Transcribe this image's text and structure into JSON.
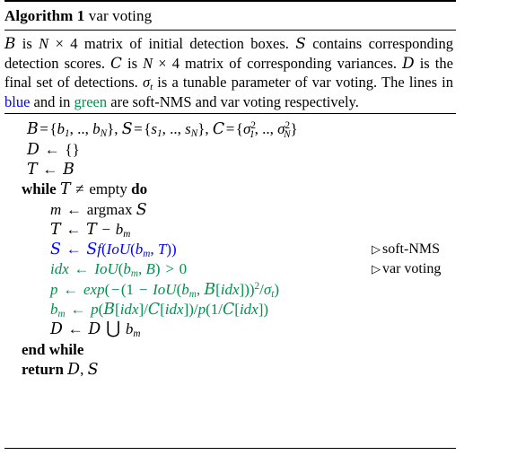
{
  "figure": {
    "type": "algorithm-block",
    "background_color": "#ffffff",
    "text_color": "#000000",
    "blue_color": "#0000ff",
    "green_color": "#00914f"
  },
  "header": {
    "label": "Algorithm 1",
    "title": "var voting"
  },
  "description": {
    "full_text": "B is N × 4 matrix of initial detection boxes. S contains corresponding detection scores. C is N × 4 matrix of corresponding variances. D is the final set of detections. σt is a tunable parameter of var voting. The lines in blue and in green are soft-NMS and var voting respectively.",
    "segments": [
      {
        "text": "B",
        "style": "mathcal"
      },
      {
        "text": " is ",
        "style": "roman"
      },
      {
        "text": "N",
        "style": "mathit"
      },
      {
        "text": " × 4 matrix of initial detection boxes. ",
        "style": "roman"
      },
      {
        "text": "S",
        "style": "mathcal"
      },
      {
        "text": " contains corresponding detection scores. ",
        "style": "roman"
      },
      {
        "text": "C",
        "style": "mathcal"
      },
      {
        "text": " is ",
        "style": "roman"
      },
      {
        "text": "N",
        "style": "mathit"
      },
      {
        "text": " × 4 matrix of corresponding variances. ",
        "style": "roman"
      },
      {
        "text": "D",
        "style": "mathcal"
      },
      {
        "text": " is the final set of detections. ",
        "style": "roman"
      },
      {
        "text": "σt",
        "style": "mathit"
      },
      {
        "text": " is a tunable parameter of var voting. The lines in ",
        "style": "roman"
      },
      {
        "text": "blue",
        "style": "blue"
      },
      {
        "text": " and in ",
        "style": "roman"
      },
      {
        "text": "green",
        "style": "green"
      },
      {
        "text": " are soft-NMS and var voting respectively.",
        "style": "roman"
      }
    ],
    "blue_word": "blue",
    "green_word": "green"
  },
  "body": {
    "lines": [
      {
        "id": "line-init-sets",
        "plain": "B = {b1, .., bN}, S = {s1, .., sN}, C = {σ²1, .., σ²N}",
        "indent": 1,
        "color": "black",
        "comment": ""
      },
      {
        "id": "line-d-empty",
        "plain": "D ← {}",
        "indent": 1,
        "color": "black",
        "comment": ""
      },
      {
        "id": "line-t-assign-b",
        "plain": "T ← B",
        "indent": 1,
        "color": "black",
        "comment": ""
      },
      {
        "id": "line-while",
        "plain": "while T ≠ empty do",
        "indent": 0,
        "color": "black",
        "comment": ""
      },
      {
        "id": "line-argmax",
        "plain": "m ← argmax S",
        "indent": 2,
        "color": "black",
        "comment": ""
      },
      {
        "id": "line-t-minus-bm",
        "plain": "T ← T − bm",
        "indent": 2,
        "color": "black",
        "comment": ""
      },
      {
        "id": "line-softnms-score",
        "plain": "S ← Sf(IoU(bm, T))",
        "indent": 2,
        "color": "blue",
        "comment": "soft-NMS"
      },
      {
        "id": "line-idx",
        "plain": "idx ← IoU(bm, B) > 0",
        "indent": 2,
        "color": "green",
        "comment": "var voting"
      },
      {
        "id": "line-p-exp",
        "plain": "p ← exp(−(1 − IoU(bm, B[idx]))²/σt)",
        "indent": 2,
        "color": "green",
        "comment": ""
      },
      {
        "id": "line-bm-update",
        "plain": "bm ← p(B[idx]/C[idx])/p(1/C[idx])",
        "indent": 2,
        "color": "green",
        "comment": ""
      },
      {
        "id": "line-d-union",
        "plain": "D ← D ⋃ bm",
        "indent": 2,
        "color": "black",
        "comment": ""
      },
      {
        "id": "line-end-while",
        "plain": "end while",
        "indent": 0,
        "color": "black",
        "comment": ""
      },
      {
        "id": "line-return",
        "plain": "return D, S",
        "indent": 0,
        "color": "black",
        "comment": ""
      }
    ],
    "keywords": {
      "while": "while",
      "do": "do",
      "empty": "empty",
      "end_while": "end while",
      "return": "return",
      "argmax": "argmax",
      "exp": "exp"
    },
    "comments": {
      "soft_nms": "soft-NMS",
      "var_voting": "var voting",
      "marker": "▷"
    }
  }
}
